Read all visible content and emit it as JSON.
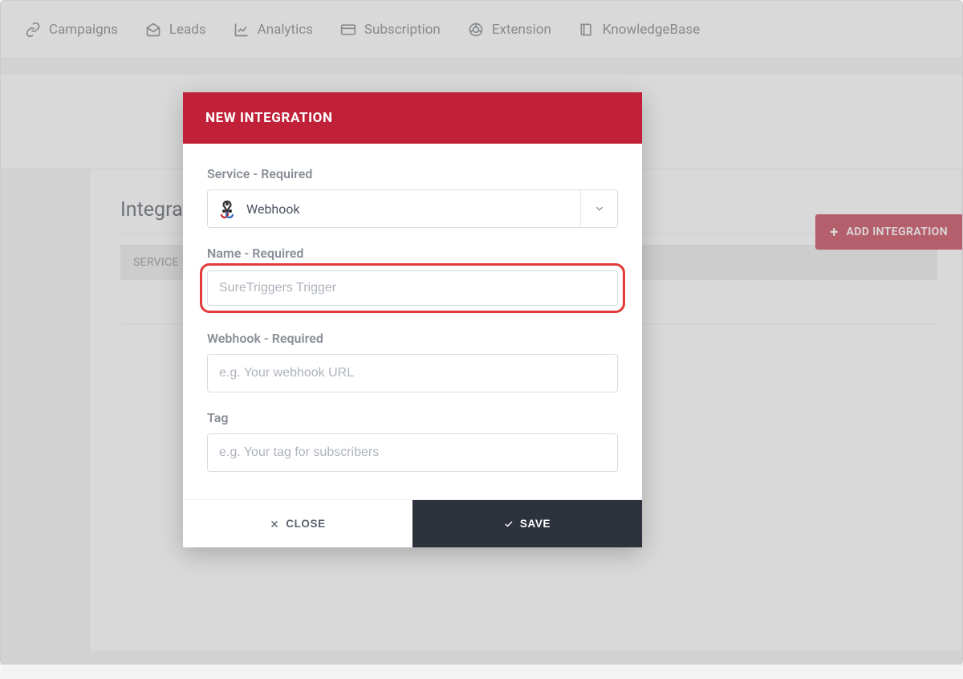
{
  "nav": {
    "items": [
      {
        "label": "Campaigns",
        "icon": "link"
      },
      {
        "label": "Leads",
        "icon": "mail"
      },
      {
        "label": "Analytics",
        "icon": "chart"
      },
      {
        "label": "Subscription",
        "icon": "card"
      },
      {
        "label": "Extension",
        "icon": "chrome"
      },
      {
        "label": "KnowledgeBase",
        "icon": "book"
      }
    ]
  },
  "page": {
    "title": "Integrat",
    "table_header_service": "SERVICE",
    "add_button": "ADD INTEGRATION"
  },
  "modal": {
    "title": "NEW INTEGRATION",
    "fields": {
      "service": {
        "label": "Service - Required",
        "value": "Webhook"
      },
      "name": {
        "label": "Name - Required",
        "placeholder": "SureTriggers Trigger",
        "value": ""
      },
      "webhook": {
        "label": "Webhook - Required",
        "placeholder": "e.g. Your webhook URL",
        "value": ""
      },
      "tag": {
        "label": "Tag",
        "placeholder": "e.g. Your tag for subscribers",
        "value": ""
      }
    },
    "buttons": {
      "close": "CLOSE",
      "save": "SAVE"
    }
  },
  "colors": {
    "brand_red": "#c02139",
    "dark": "#2d323c",
    "highlight": "#e23a3a"
  }
}
